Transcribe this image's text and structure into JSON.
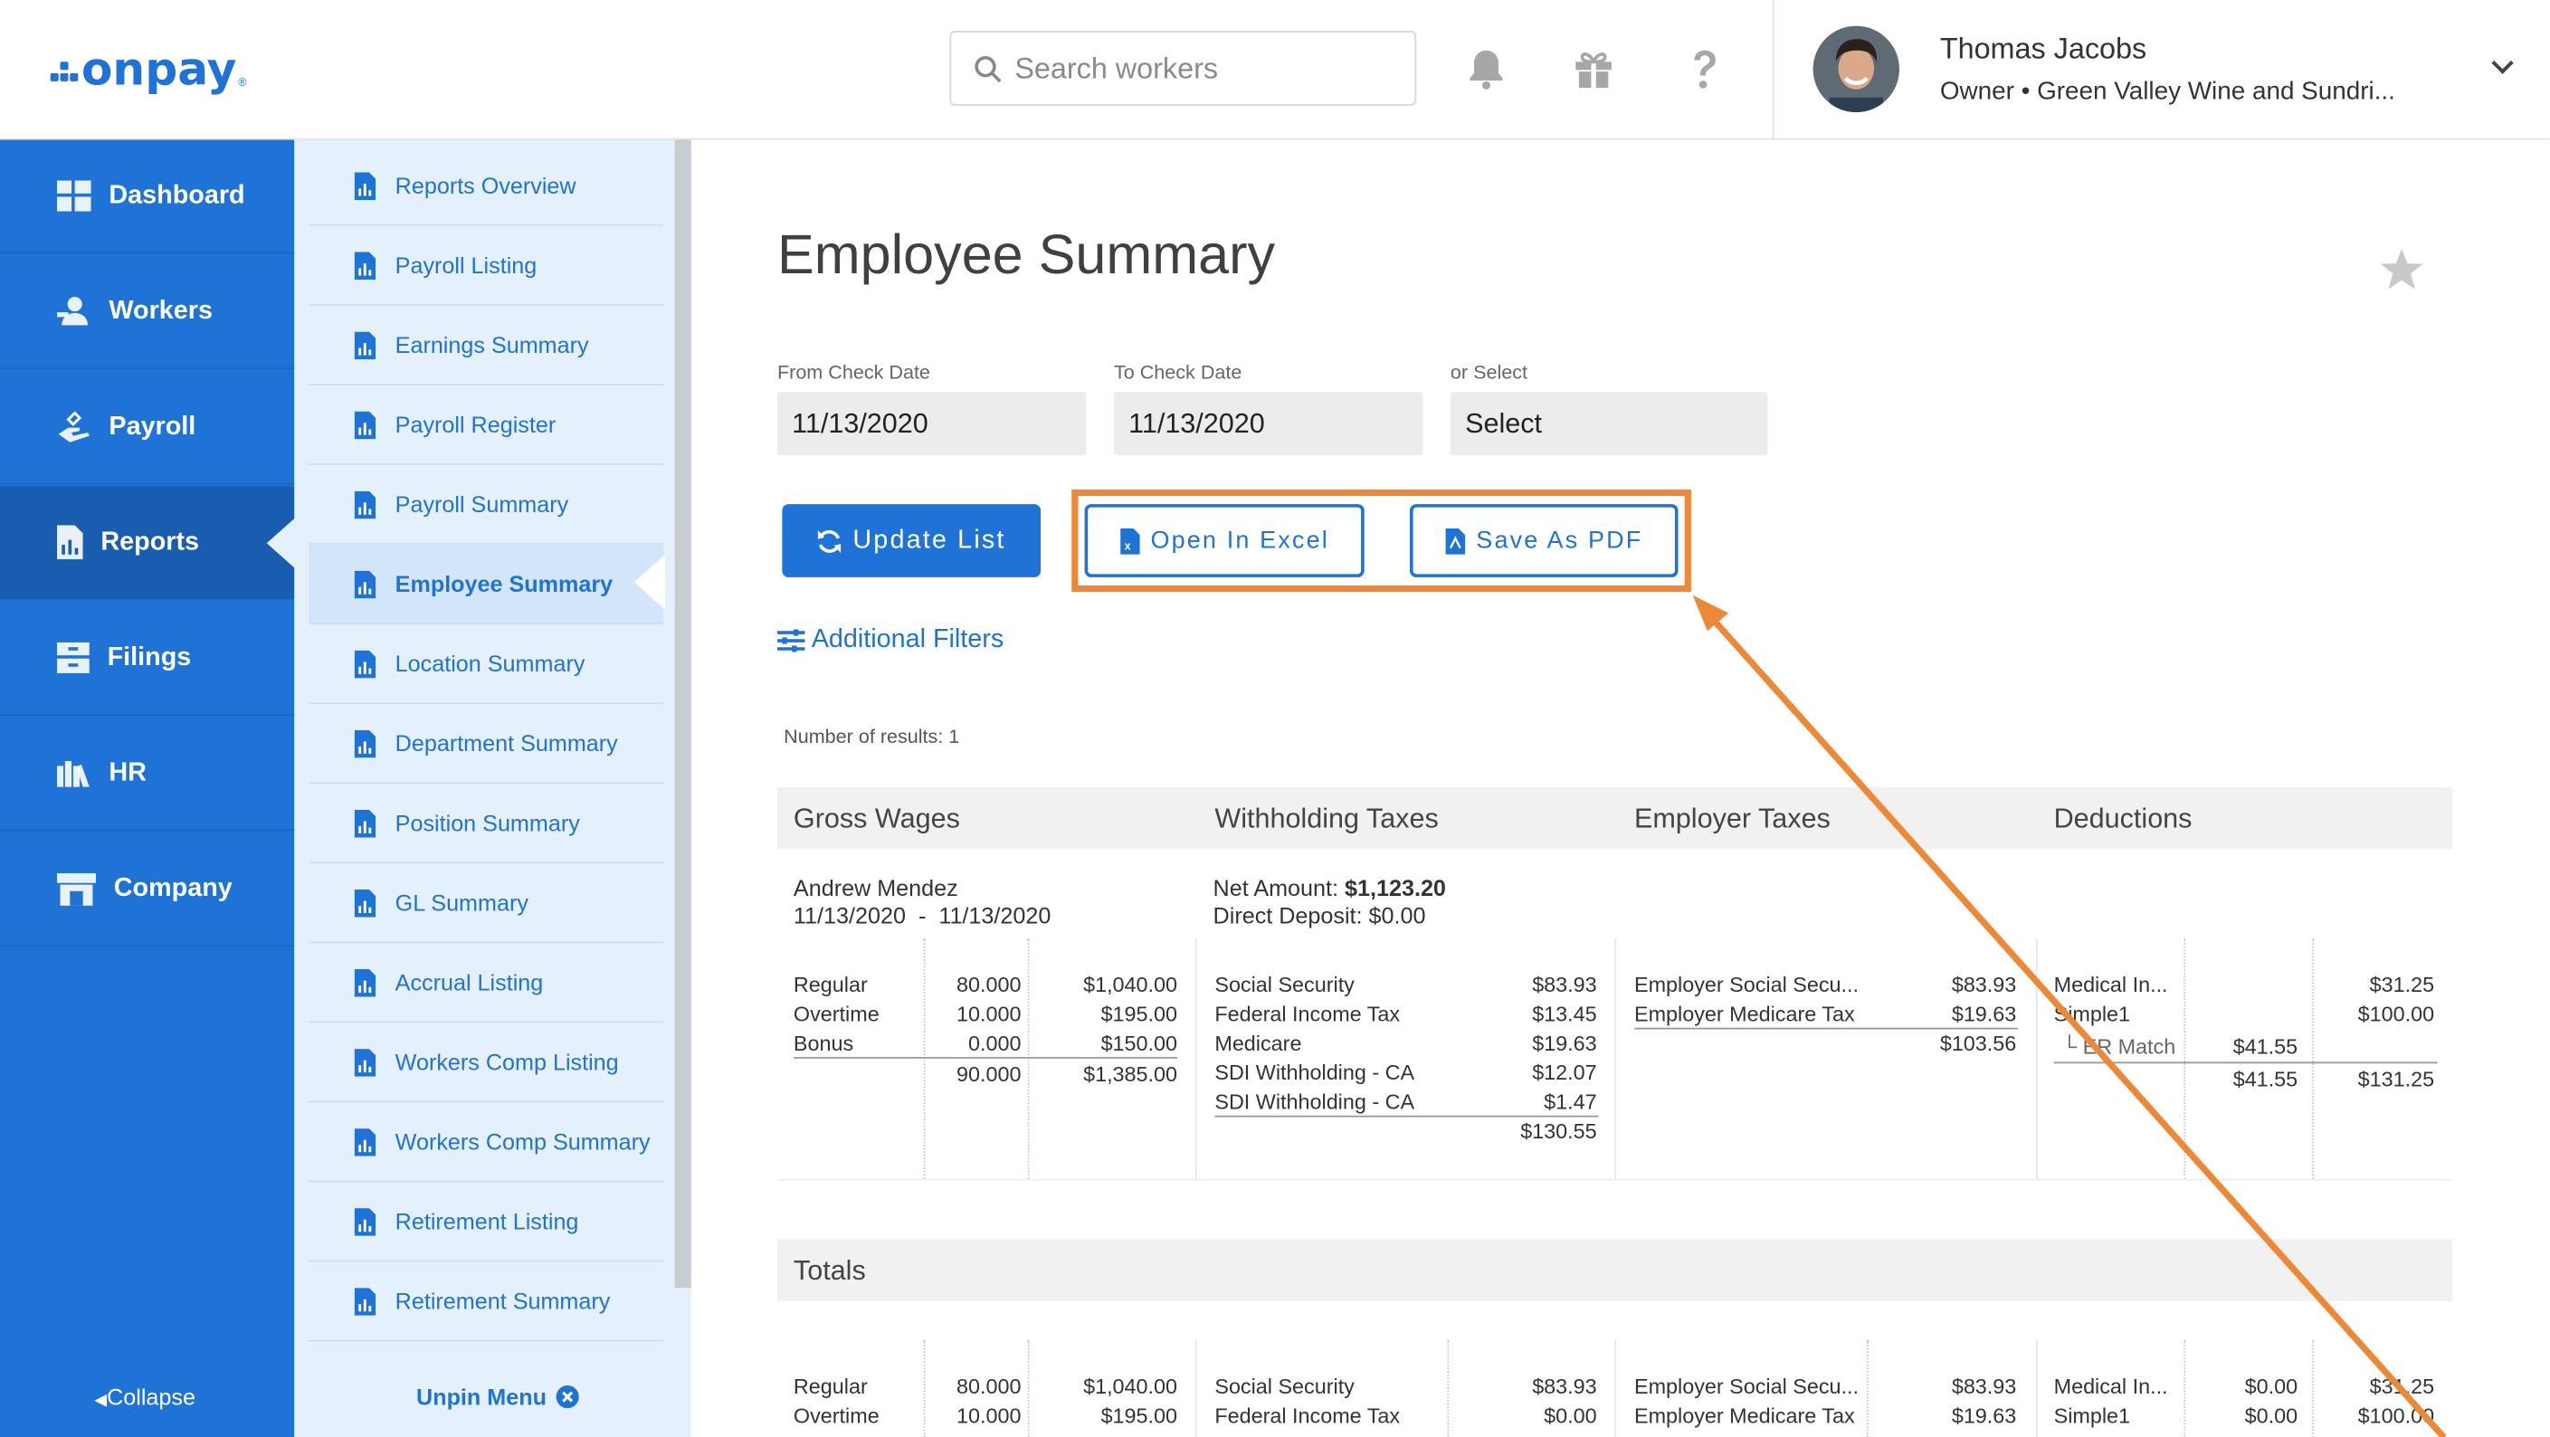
{
  "brand": {
    "logo_text": "onpay",
    "logo_mark": "®",
    "color": "#1f73d6"
  },
  "header": {
    "search_placeholder": "Search workers",
    "icons": [
      "bell-icon",
      "gift-icon",
      "help-icon"
    ],
    "user": {
      "name": "Thomas Jacobs",
      "role": "Owner • Green Valley Wine and Sundri..."
    }
  },
  "nav": {
    "items": [
      {
        "label": "Dashboard",
        "icon": "dashboard-icon"
      },
      {
        "label": "Workers",
        "icon": "workers-icon"
      },
      {
        "label": "Payroll",
        "icon": "payroll-icon"
      },
      {
        "label": "Reports",
        "icon": "reports-icon",
        "active": true
      },
      {
        "label": "Filings",
        "icon": "filings-icon"
      },
      {
        "label": "HR",
        "icon": "hr-icon"
      },
      {
        "label": "Company",
        "icon": "company-icon"
      }
    ],
    "collapse_label": "Collapse"
  },
  "subnav": {
    "items": [
      "Reports Overview",
      "Payroll Listing",
      "Earnings Summary",
      "Payroll Register",
      "Payroll Summary",
      "Employee Summary",
      "Location Summary",
      "Department Summary",
      "Position Summary",
      "GL Summary",
      "Accrual Listing",
      "Workers Comp Listing",
      "Workers Comp Summary",
      "Retirement Listing",
      "Retirement Summary"
    ],
    "active": "Employee Summary",
    "unpin_label": "Unpin Menu"
  },
  "main": {
    "title": "Employee Summary",
    "from_label": "From Check Date",
    "from_value": "11/13/2020",
    "to_label": "To Check Date",
    "to_value": "11/13/2020",
    "select_label": "or Select",
    "select_value": "Select",
    "update_label": "Update List",
    "excel_label": "Open In Excel",
    "pdf_label": "Save As PDF",
    "filters_label": "Additional Filters",
    "results_label": "Number of results: 1",
    "headers": [
      "Gross Wages",
      "Withholding Taxes",
      "Employer Taxes",
      "Deductions"
    ],
    "employee": {
      "name": "Andrew Mendez",
      "date_range": "11/13/2020  -  11/13/2020",
      "net_label": "Net Amount:",
      "net_value": "$1,123.20",
      "dd_label": "Direct Deposit: $0.00"
    },
    "wages": [
      {
        "label": "Regular",
        "hours": "80.000",
        "amount": "$1,040.00"
      },
      {
        "label": "Overtime",
        "hours": "10.000",
        "amount": "$195.00"
      },
      {
        "label": "Bonus",
        "hours": "0.000",
        "amount": "$150.00"
      }
    ],
    "wages_total": {
      "hours": "90.000",
      "amount": "$1,385.00"
    },
    "withholding": [
      {
        "label": "Social Security",
        "amount": "$83.93"
      },
      {
        "label": "Federal Income Tax",
        "amount": "$13.45"
      },
      {
        "label": "Medicare",
        "amount": "$19.63"
      },
      {
        "label": "SDI Withholding - CA",
        "amount": "$12.07"
      },
      {
        "label": "SDI Withholding - CA",
        "amount": "$1.47"
      }
    ],
    "withholding_total": "$130.55",
    "employer": [
      {
        "label": "Employer Social Secu...",
        "amount": "$83.93"
      },
      {
        "label": "Employer Medicare Tax",
        "amount": "$19.63"
      }
    ],
    "employer_total": "$103.56",
    "deductions": [
      {
        "label": "Medical In...",
        "er": "",
        "amount": "$31.25"
      },
      {
        "label": "Simple1",
        "er": "",
        "amount": "$100.00"
      },
      {
        "label": "└ ER Match",
        "er": "$41.55",
        "amount": ""
      }
    ],
    "deductions_total": {
      "er": "$41.55",
      "amount": "$131.25"
    },
    "totals_label": "Totals",
    "totals_wages": [
      {
        "label": "Regular",
        "hours": "80.000",
        "amount": "$1,040.00"
      },
      {
        "label": "Overtime",
        "hours": "10.000",
        "amount": "$195.00"
      }
    ],
    "totals_withholding": [
      {
        "label": "Social Security",
        "amount": "$83.93"
      },
      {
        "label": "Federal Income Tax",
        "amount": "$0.00"
      }
    ],
    "totals_employer": [
      {
        "label": "Employer Social Secu...",
        "amount": "$83.93"
      },
      {
        "label": "Employer Medicare Tax",
        "amount": "$19.63"
      }
    ],
    "totals_deductions": [
      {
        "label": "Medical In...",
        "er": "$0.00",
        "amount": "$31.25"
      },
      {
        "label": "Simple1",
        "er": "$0.00",
        "amount": "$100.00"
      }
    ]
  },
  "annotation": {
    "color": "#ed8936"
  }
}
